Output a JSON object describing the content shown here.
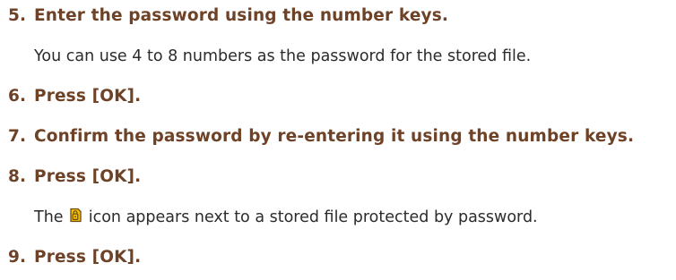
{
  "steps": [
    {
      "number": "5.",
      "title": "Enter the password using the number keys.",
      "body": "You can use 4 to 8 numbers as the password for the stored file."
    },
    {
      "number": "6.",
      "title": "Press [OK]."
    },
    {
      "number": "7.",
      "title": "Confirm the password by re-entering it using the number keys."
    },
    {
      "number": "8.",
      "title": "Press [OK].",
      "body_before_icon": "The",
      "body_icon": "password-protected-file-icon",
      "body_after_icon": "icon appears next to a stored file protected by password."
    },
    {
      "number": "9.",
      "title": "Press [OK]."
    }
  ],
  "colors": {
    "step_title": "#6e4226",
    "body_text": "#2b2b2b",
    "icon_fill": "#f2c200",
    "icon_outline": "#6b4a1a"
  }
}
